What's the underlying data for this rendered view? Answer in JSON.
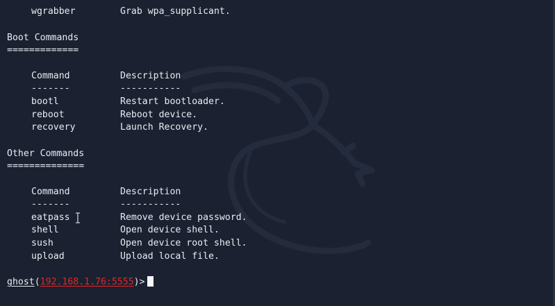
{
  "top_row": {
    "command": "wgrabber",
    "description": "Grab wpa_supplicant."
  },
  "boot": {
    "title": "Boot Commands",
    "underline": "=============",
    "header": {
      "command": "Command",
      "description": "Description"
    },
    "sep": {
      "command": "-------",
      "description": "-----------"
    },
    "rows": [
      {
        "command": "bootl",
        "description": "Restart bootloader."
      },
      {
        "command": "reboot",
        "description": "Reboot device."
      },
      {
        "command": "recovery",
        "description": "Launch Recovery."
      }
    ]
  },
  "other": {
    "title": "Other Commands",
    "underline": "==============",
    "header": {
      "command": "Command",
      "description": "Description"
    },
    "sep": {
      "command": "-------",
      "description": "-----------"
    },
    "rows": [
      {
        "command": "eatpass",
        "description": "Remove device password."
      },
      {
        "command": "shell",
        "description": "Open device shell."
      },
      {
        "command": "sush",
        "description": "Open device root shell."
      },
      {
        "command": "upload",
        "description": "Upload local file."
      }
    ]
  },
  "prompt": {
    "user": "ghost",
    "open": "(",
    "host": "192.168.1.76:5555",
    "close": ")>"
  },
  "colors": {
    "background": "#1b2130",
    "text": "#e8ecf2",
    "host": "#e0262a"
  },
  "icons": {
    "background": "kali-dragon-logo",
    "mouse": "text-cursor-icon"
  }
}
